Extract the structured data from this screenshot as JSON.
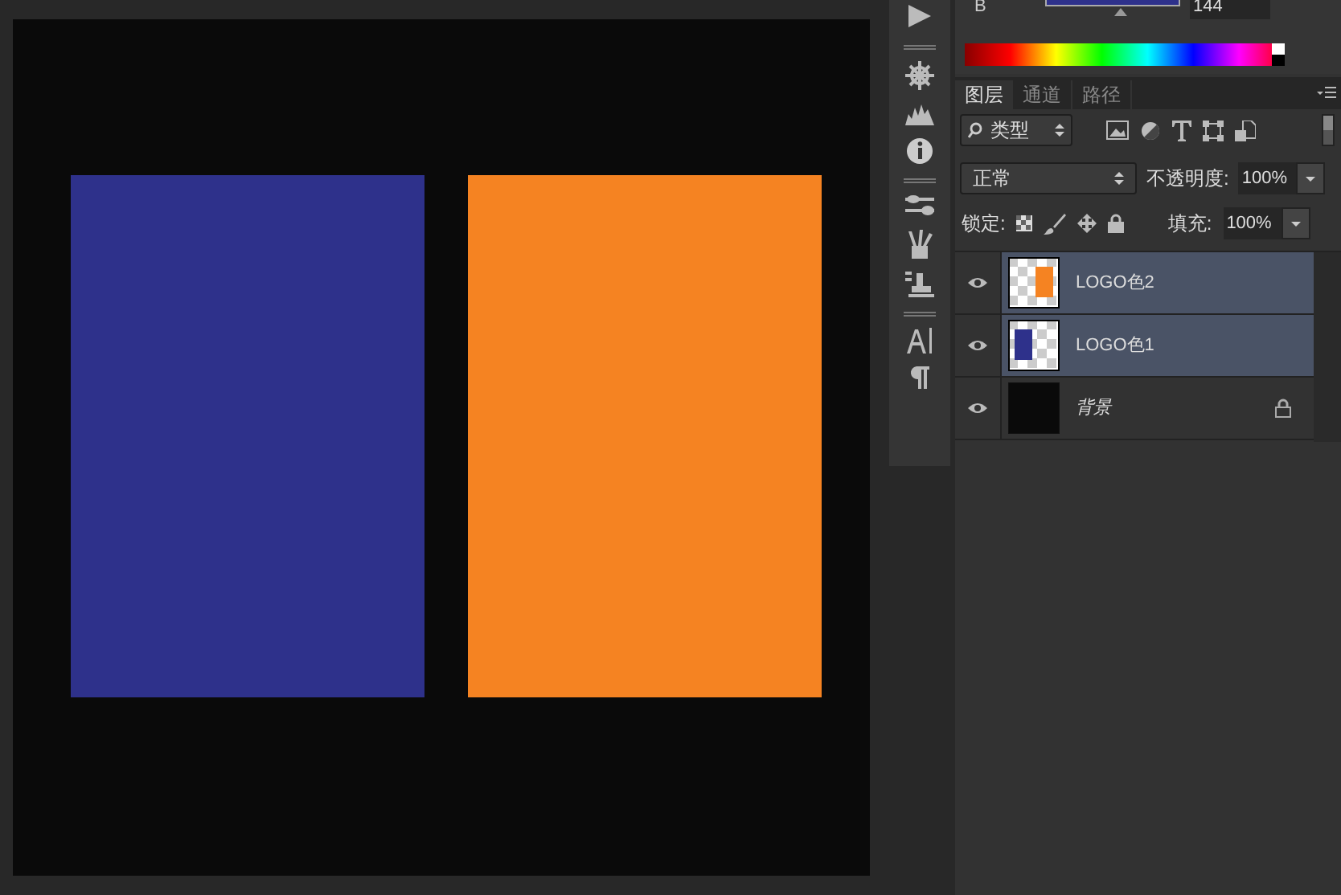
{
  "color_panel": {
    "channel_label": "B",
    "channel_value": "144",
    "slider": {
      "level": 0.56
    }
  },
  "tabs": [
    {
      "label": "图层",
      "selected": true
    },
    {
      "label": "通道",
      "selected": false
    },
    {
      "label": "路径",
      "selected": false
    }
  ],
  "filter": {
    "value": "类型"
  },
  "blend": {
    "mode": "正常",
    "opacity_label": "不透明度:",
    "opacity": "100%"
  },
  "lock": {
    "label": "锁定:",
    "fill_label": "填充:",
    "fill": "100%"
  },
  "layers": [
    {
      "name": "LOGO色2",
      "selected": true,
      "visible": true,
      "locked": false,
      "kind": "pixel",
      "color": "#f58322",
      "italic": false
    },
    {
      "name": "LOGO色1",
      "selected": true,
      "visible": true,
      "locked": false,
      "kind": "pixel",
      "color": "#2e318b",
      "italic": false
    },
    {
      "name": "背景",
      "selected": false,
      "visible": true,
      "locked": true,
      "kind": "background",
      "italic": true
    }
  ],
  "canvas": {
    "shapes": [
      {
        "color": "#2e318b"
      },
      {
        "color": "#f58322"
      }
    ]
  }
}
